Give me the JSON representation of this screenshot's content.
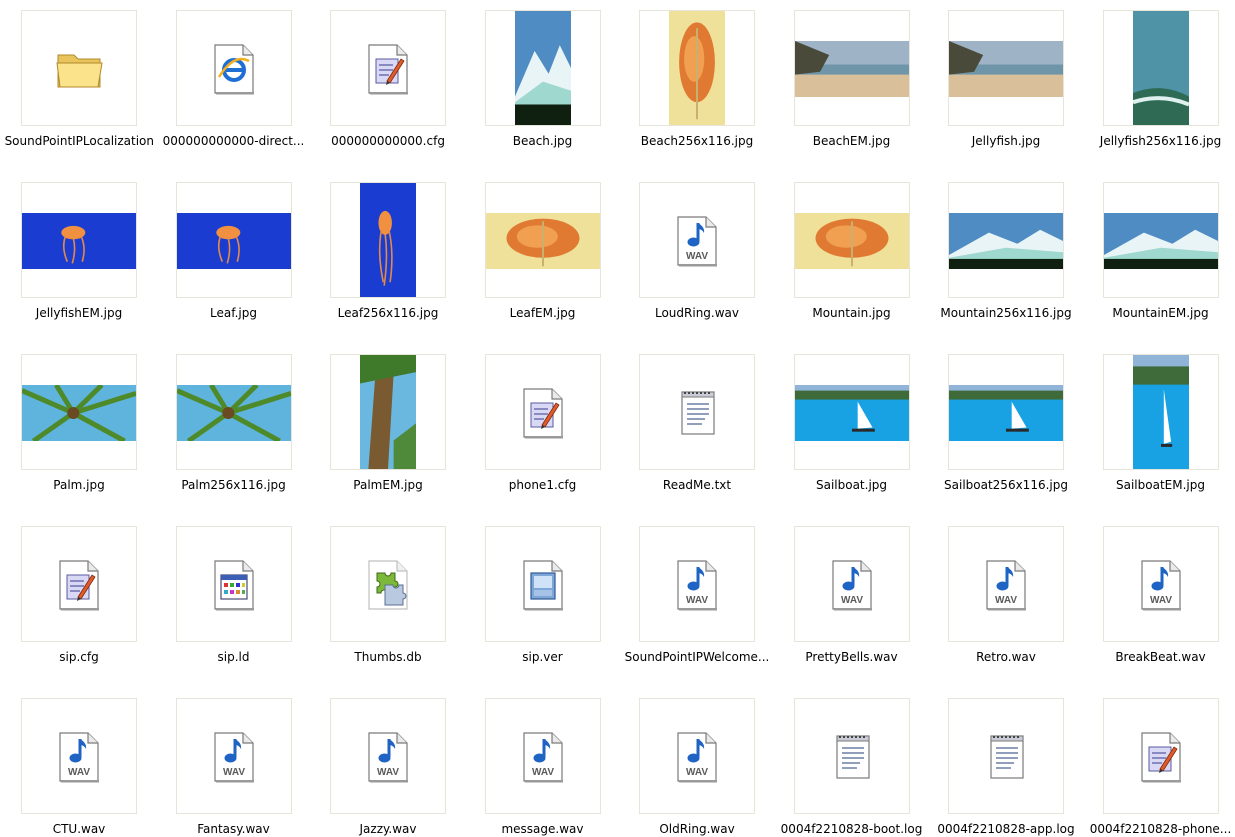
{
  "files": [
    {
      "name": "SoundPointIPLocalization",
      "kind": "folder",
      "icon": "folder-icon"
    },
    {
      "name": "000000000000-direct...",
      "kind": "web",
      "icon": "internet-explorer-icon"
    },
    {
      "name": "000000000000.cfg",
      "kind": "cfg",
      "icon": "config-file-icon"
    },
    {
      "name": "Beach.jpg",
      "kind": "tall",
      "scene": "mountain",
      "icon": "image-thumbnail"
    },
    {
      "name": "Beach256x116.jpg",
      "kind": "tall",
      "scene": "leaf",
      "icon": "image-thumbnail"
    },
    {
      "name": "BeachEM.jpg",
      "kind": "wide",
      "scene": "beach",
      "icon": "image-thumbnail"
    },
    {
      "name": "Jellyfish.jpg",
      "kind": "wide",
      "scene": "beach",
      "icon": "image-thumbnail"
    },
    {
      "name": "Jellyfish256x116.jpg",
      "kind": "tall",
      "scene": "wave",
      "icon": "image-thumbnail"
    },
    {
      "name": "JellyfishEM.jpg",
      "kind": "wide",
      "scene": "jellyfish",
      "icon": "image-thumbnail"
    },
    {
      "name": "Leaf.jpg",
      "kind": "wide",
      "scene": "jellyfish",
      "icon": "image-thumbnail"
    },
    {
      "name": "Leaf256x116.jpg",
      "kind": "tall",
      "scene": "jellyfish",
      "icon": "image-thumbnail"
    },
    {
      "name": "LeafEM.jpg",
      "kind": "wide",
      "scene": "leaf",
      "icon": "image-thumbnail"
    },
    {
      "name": "LoudRing.wav",
      "kind": "wav",
      "icon": "wav-audio-icon"
    },
    {
      "name": "Mountain.jpg",
      "kind": "wide",
      "scene": "leaf",
      "icon": "image-thumbnail"
    },
    {
      "name": "Mountain256x116.jpg",
      "kind": "wide",
      "scene": "mountain",
      "icon": "image-thumbnail"
    },
    {
      "name": "MountainEM.jpg",
      "kind": "wide",
      "scene": "mountain",
      "icon": "image-thumbnail"
    },
    {
      "name": "Palm.jpg",
      "kind": "wide",
      "scene": "palm",
      "icon": "image-thumbnail"
    },
    {
      "name": "Palm256x116.jpg",
      "kind": "wide",
      "scene": "palm",
      "icon": "image-thumbnail"
    },
    {
      "name": "PalmEM.jpg",
      "kind": "tall",
      "scene": "palmtrunk",
      "icon": "image-thumbnail"
    },
    {
      "name": "phone1.cfg",
      "kind": "cfg",
      "icon": "config-file-icon"
    },
    {
      "name": "ReadMe.txt",
      "kind": "txt",
      "icon": "notepad-text-icon"
    },
    {
      "name": "Sailboat.jpg",
      "kind": "wide",
      "scene": "sailboat",
      "icon": "image-thumbnail"
    },
    {
      "name": "Sailboat256x116.jpg",
      "kind": "wide",
      "scene": "sailboat",
      "icon": "image-thumbnail"
    },
    {
      "name": "SailboatEM.jpg",
      "kind": "tall",
      "scene": "sailboat",
      "icon": "image-thumbnail"
    },
    {
      "name": "sip.cfg",
      "kind": "cfg",
      "icon": "config-file-icon"
    },
    {
      "name": "sip.ld",
      "kind": "ld",
      "icon": "application-file-icon"
    },
    {
      "name": "Thumbs.db",
      "kind": "db",
      "icon": "thumbs-db-icon"
    },
    {
      "name": "sip.ver",
      "kind": "ver",
      "icon": "version-file-icon"
    },
    {
      "name": "SoundPointIPWelcome...",
      "kind": "wav",
      "icon": "wav-audio-icon"
    },
    {
      "name": "PrettyBells.wav",
      "kind": "wav",
      "icon": "wav-audio-icon"
    },
    {
      "name": "Retro.wav",
      "kind": "wav",
      "icon": "wav-audio-icon"
    },
    {
      "name": "BreakBeat.wav",
      "kind": "wav",
      "icon": "wav-audio-icon"
    },
    {
      "name": "CTU.wav",
      "kind": "wav",
      "icon": "wav-audio-icon"
    },
    {
      "name": "Fantasy.wav",
      "kind": "wav",
      "icon": "wav-audio-icon"
    },
    {
      "name": "Jazzy.wav",
      "kind": "wav",
      "icon": "wav-audio-icon"
    },
    {
      "name": "message.wav",
      "kind": "wav",
      "icon": "wav-audio-icon"
    },
    {
      "name": "OldRing.wav",
      "kind": "wav",
      "icon": "wav-audio-icon"
    },
    {
      "name": "0004f2210828-boot.log",
      "kind": "txt",
      "icon": "notepad-text-icon"
    },
    {
      "name": "0004f2210828-app.log",
      "kind": "txt",
      "icon": "notepad-text-icon"
    },
    {
      "name": "0004f2210828-phone...",
      "kind": "cfg",
      "icon": "config-file-icon"
    }
  ],
  "wav_badge": "WAV"
}
